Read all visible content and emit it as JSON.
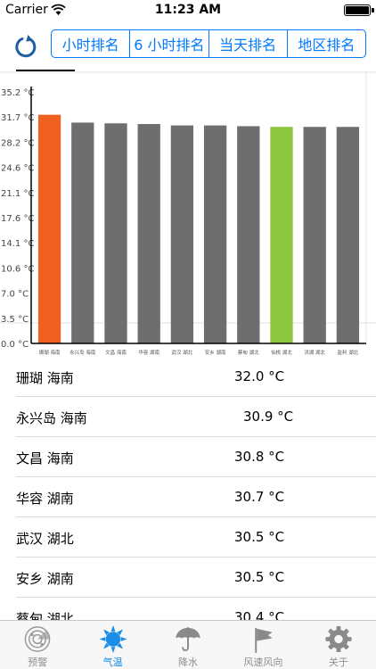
{
  "status": {
    "carrier": "Carrier",
    "time": "11:23 AM"
  },
  "nav": {
    "segments": [
      "小时排名",
      "6 小时排名",
      "当天排名",
      "地区排名"
    ],
    "selected_index": 0
  },
  "colors": {
    "accent": "#007aff",
    "bar_default": "#6e6e6e",
    "bar_max": "#f06020",
    "bar_highlight": "#8cc63f",
    "tab_active": "#1a8de6"
  },
  "chart_data": {
    "type": "bar",
    "categories": [
      "珊瑚 海南",
      "永兴岛 海南",
      "文昌 海南",
      "华容 湖南",
      "武汉 湖北",
      "安乡 湖南",
      "蔡甸 湖北",
      "仙桃 湖北",
      "洪湖 湖北",
      "监利 湖北"
    ],
    "values": [
      32.0,
      30.9,
      30.8,
      30.7,
      30.5,
      30.5,
      30.4,
      30.3,
      30.3,
      30.3
    ],
    "highlight": {
      "max_index": 0,
      "selected_index": 7
    },
    "y_ticks": [
      "35.2 °C",
      "31.7 °C",
      "28.2 °C",
      "24.6 °C",
      "21.1 °C",
      "17.6 °C",
      "14.1 °C",
      "10.6 °C",
      "7.0 °C",
      "3.5 °C",
      "0.0 °C"
    ],
    "ylim": [
      0,
      35.2
    ]
  },
  "list": [
    {
      "name": "珊瑚 海南",
      "value": "32.0 °C"
    },
    {
      "name": "永兴岛 海南",
      "value": "30.9 °C"
    },
    {
      "name": "文昌 海南",
      "value": "30.8 °C"
    },
    {
      "name": "华容 湖南",
      "value": "30.7 °C"
    },
    {
      "name": "武汉 湖北",
      "value": "30.5 °C"
    },
    {
      "name": "安乡 湖南",
      "value": "30.5 °C"
    },
    {
      "name": "蔡甸 湖北",
      "value": "30.4 °C"
    }
  ],
  "tabs": [
    {
      "label": "预警",
      "icon": "radar-icon"
    },
    {
      "label": "气温",
      "icon": "sun-icon"
    },
    {
      "label": "降水",
      "icon": "umbrella-icon"
    },
    {
      "label": "风速风向",
      "icon": "flag-icon"
    },
    {
      "label": "关于",
      "icon": "gear-icon"
    }
  ],
  "active_tab": 1
}
